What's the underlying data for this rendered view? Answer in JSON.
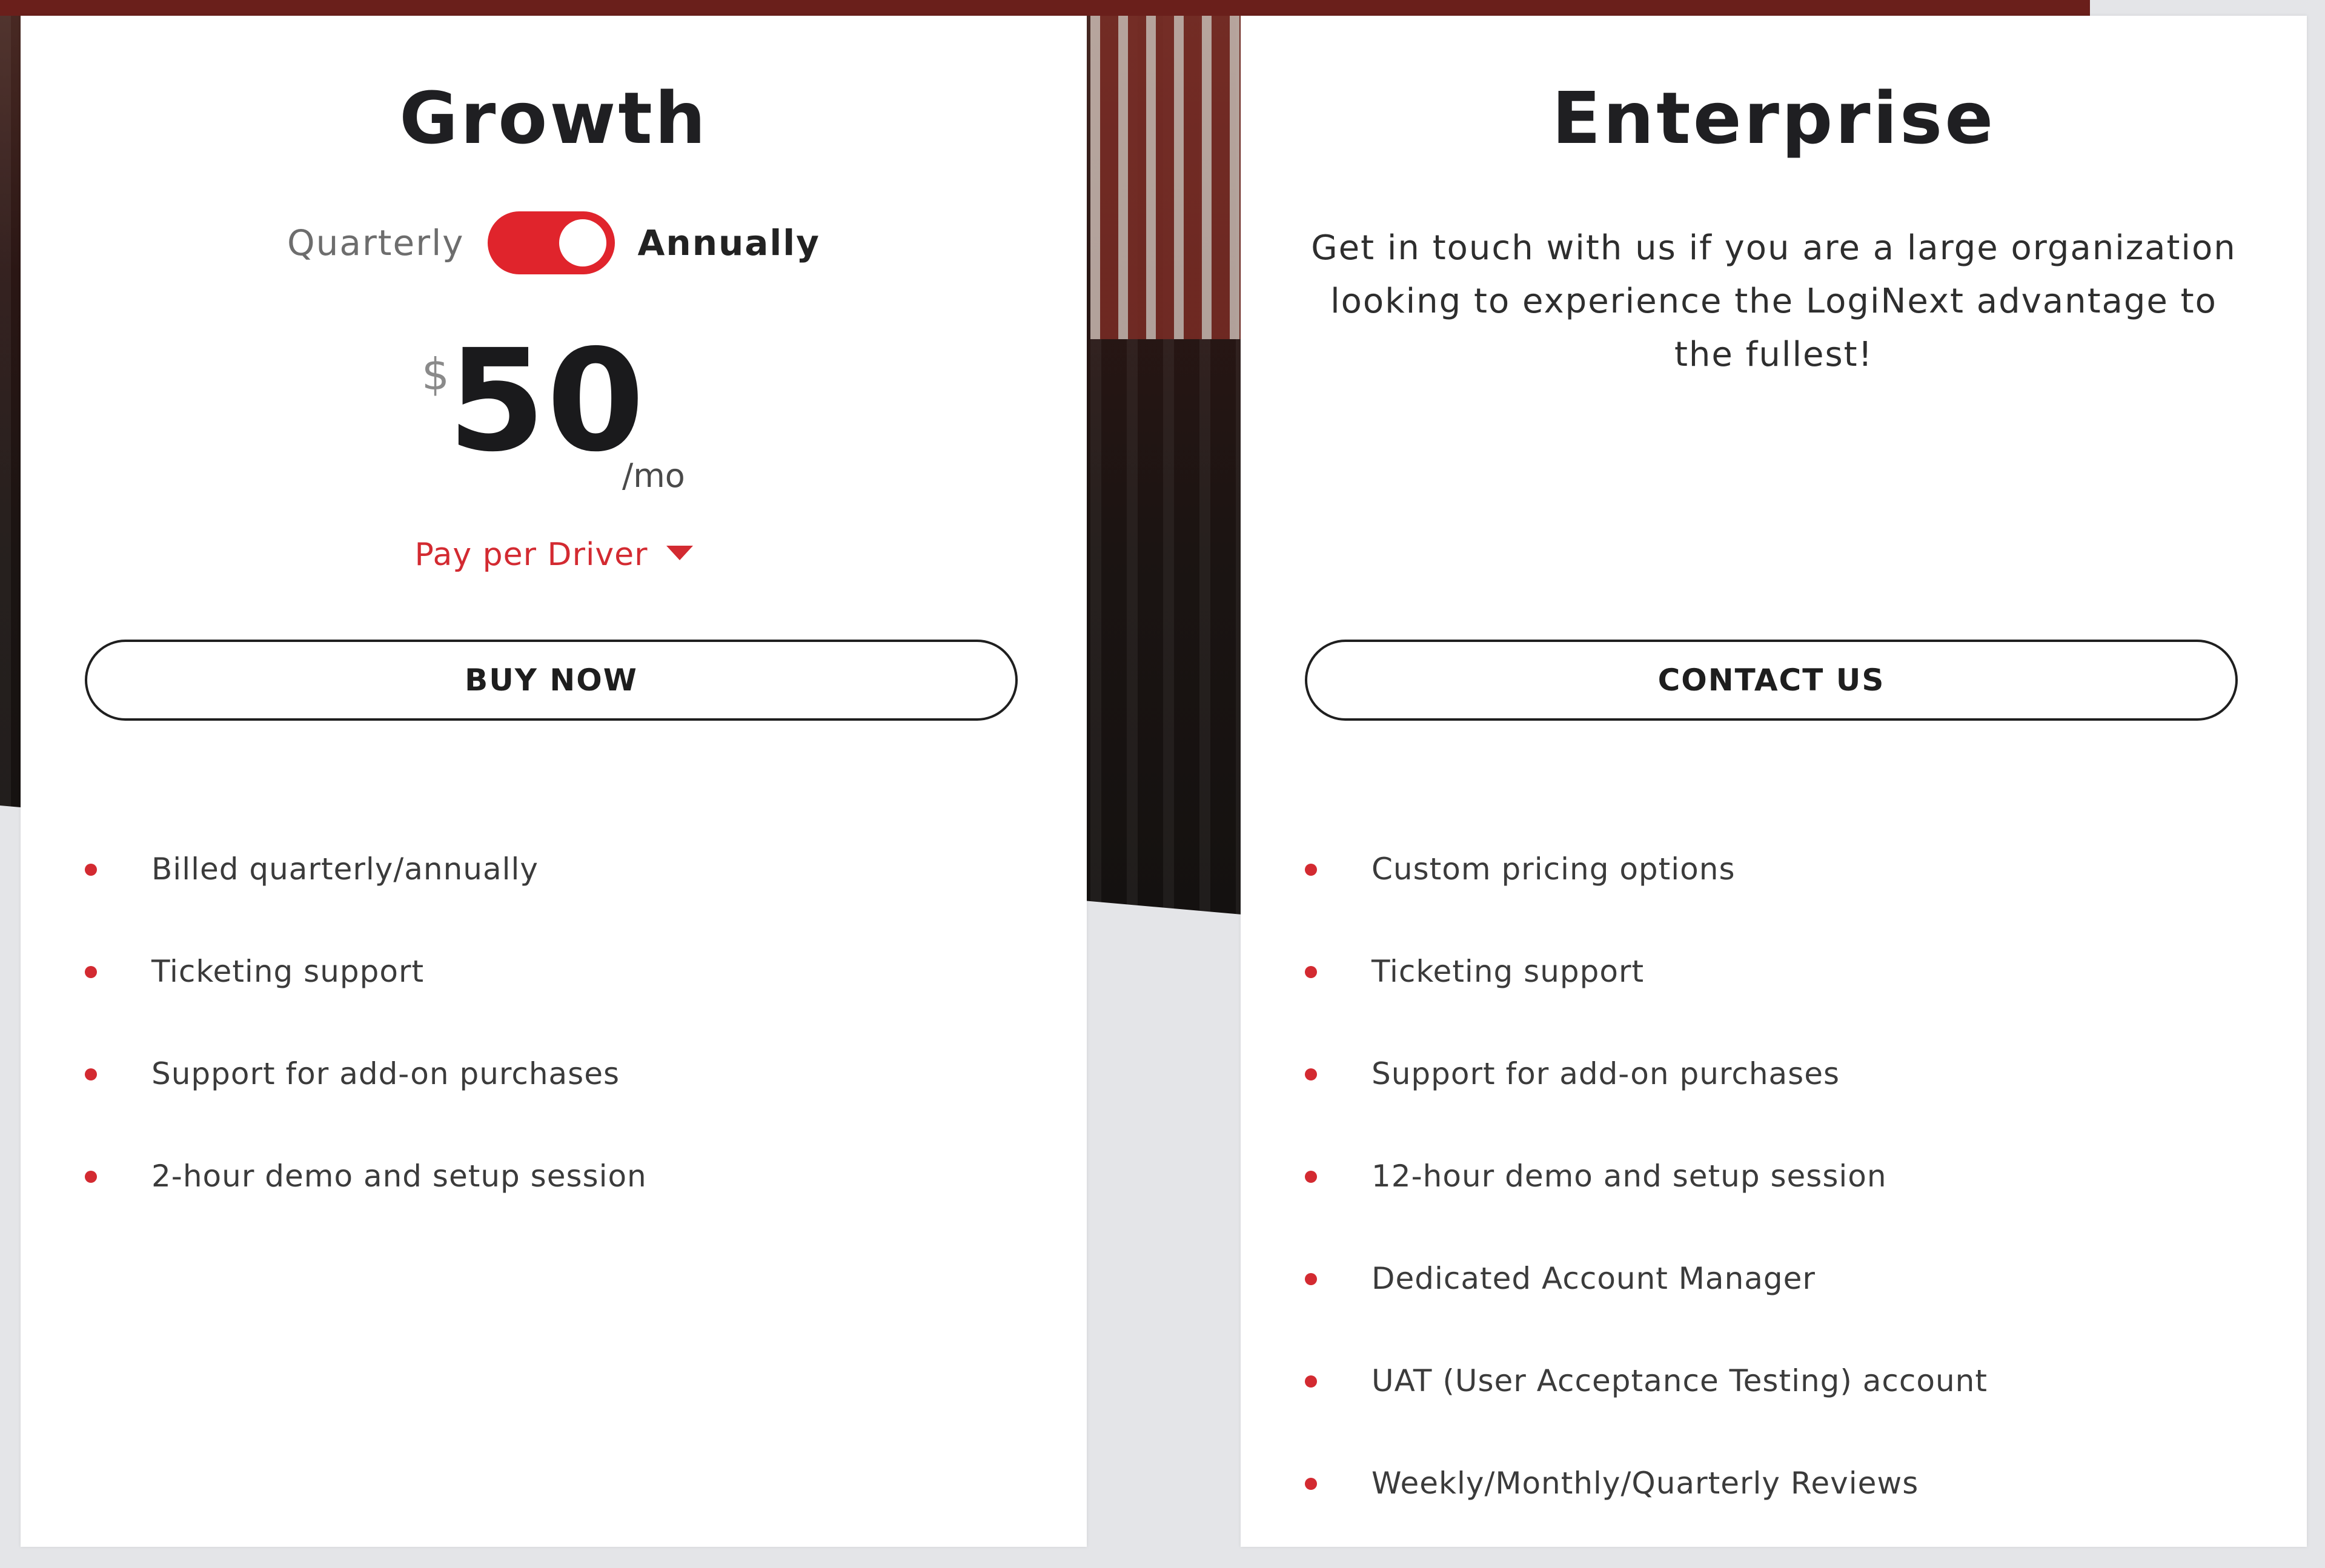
{
  "colors": {
    "accent": "#d32a31",
    "toggle_on": "#e0242c",
    "card_bg": "#ffffff",
    "page_bg": "#e4e5e8"
  },
  "growth": {
    "title": "Growth",
    "billing": {
      "option_left": "Quarterly",
      "option_right": "Annually",
      "selected": "Annually"
    },
    "price": {
      "currency": "$",
      "amount": "50",
      "period": "/mo"
    },
    "pricing_basis": "Pay per Driver",
    "button_label": "BUY NOW",
    "features": [
      "Billed quarterly/annually",
      "Ticketing support",
      "Support for add-on purchases",
      "2-hour demo and setup session"
    ]
  },
  "enterprise": {
    "title": "Enterprise",
    "description": "Get in touch with us if you are a large organization looking to experience the LogiNext advantage to the fullest!",
    "button_label": "CONTACT US",
    "features": [
      "Custom pricing options",
      "Ticketing support",
      "Support for add-on purchases",
      "12-hour demo and setup session",
      "Dedicated Account Manager",
      "UAT (User Acceptance Testing) account",
      "Weekly/Monthly/Quarterly Reviews"
    ]
  }
}
